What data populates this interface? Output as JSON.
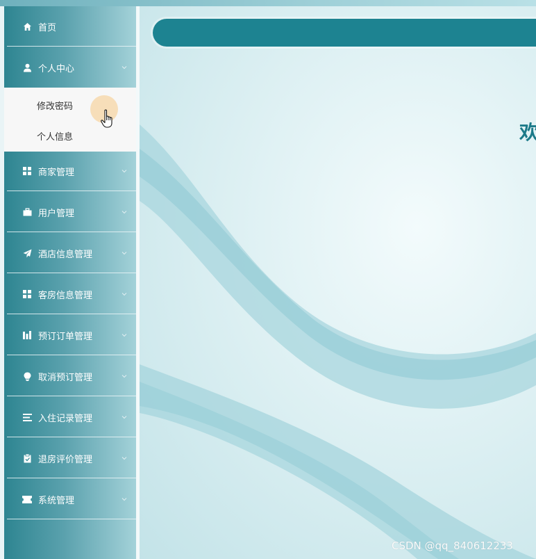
{
  "sidebar": {
    "items": [
      {
        "label": "首页",
        "icon": "home-icon",
        "has_chevron": false
      },
      {
        "label": "个人中心",
        "icon": "user-icon",
        "has_chevron": true,
        "expanded": true
      },
      {
        "label": "商家管理",
        "icon": "grid-icon",
        "has_chevron": true
      },
      {
        "label": "用户管理",
        "icon": "briefcase-icon",
        "has_chevron": true
      },
      {
        "label": "酒店信息管理",
        "icon": "paper-plane-icon",
        "has_chevron": true
      },
      {
        "label": "客房信息管理",
        "icon": "grid-icon",
        "has_chevron": true
      },
      {
        "label": "预订订单管理",
        "icon": "bar-chart-icon",
        "has_chevron": true
      },
      {
        "label": "取消预订管理",
        "icon": "lightbulb-icon",
        "has_chevron": true
      },
      {
        "label": "入住记录管理",
        "icon": "list-icon",
        "has_chevron": true
      },
      {
        "label": "退房评价管理",
        "icon": "clipboard-icon",
        "has_chevron": true
      },
      {
        "label": "系统管理",
        "icon": "ticket-icon",
        "has_chevron": true
      }
    ],
    "submenu": [
      {
        "label": "修改密码"
      },
      {
        "label": "个人信息"
      }
    ]
  },
  "main": {
    "welcome_text": "欢"
  },
  "watermark": "CSDN @qq_840612233",
  "colors": {
    "sidebar_dark": "#2e8591",
    "sidebar_light": "#a4d2d9",
    "header_bar": "#1d8391",
    "welcome_text": "#1c7a89",
    "hover_highlight": "#f6d39e"
  }
}
